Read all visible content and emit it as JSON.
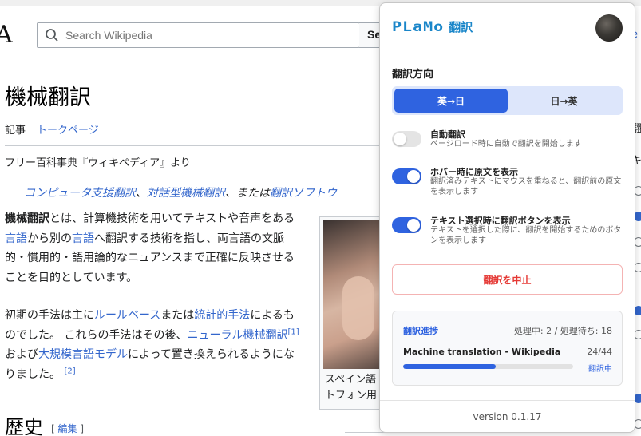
{
  "wiki": {
    "logo_fragment": "A",
    "search_placeholder": "Search Wikipedia",
    "search_button": "Se",
    "page_title": "機械翻訳",
    "tabs": {
      "article": "記事",
      "talk": "トークページ"
    },
    "from_line": "フリー百科事典『ウィキペディア』より",
    "hatnote": {
      "link1": "コンピュータ支援翻訳",
      "sep1": "、",
      "link2": "対話型機械翻訳",
      "sep2": "、または",
      "link3": "翻訳ソフトウ"
    },
    "para1": {
      "bold": "機械翻訳",
      "t1": "とは、計算機技術を用いてテキストや音声をある",
      "link1": "言語",
      "t2": "から別の",
      "link2": "言語",
      "t3": "へ翻訳する技術を指し、両言語の文脈的・慣用的・語用論的なニュアンスまで正確に反映させることを目的としています。"
    },
    "para2": {
      "t1": "初期の手法は主に",
      "link1": "ルールベース",
      "t2": "または",
      "link2": "統計的手法",
      "t3": "によるものでした。 これらの手法はその後、",
      "link3": "ニューラル機械翻訳",
      "ref1": "[1]",
      "t4": "および",
      "link4": "大規模言語モデル",
      "t5": "によって置き換えられるようになりました。 ",
      "ref2": "[2]"
    },
    "figure_caption_1": "スペイン語",
    "figure_caption_2": "トフォン用",
    "section_heading": "歴史",
    "edit_open": "[ ",
    "edit_link": "編集",
    "edit_close": " ]",
    "right_fragments": [
      "e",
      "翻",
      "キ"
    ]
  },
  "popup": {
    "brand_logo": "PLaMo",
    "brand_suffix": "翻訳",
    "direction_label": "翻訳方向",
    "direction_options": [
      "英→日",
      "日→英"
    ],
    "options": [
      {
        "title": "自動翻訳",
        "desc": "ページロード時に自動で翻訳を開始します",
        "enabled": false
      },
      {
        "title": "ホバー時に原文を表示",
        "desc": "翻訳済みテキストにマウスを重ねると、翻訳前の原文を表示します",
        "enabled": true
      },
      {
        "title": "テキスト選択時に翻訳ボタンを表示",
        "desc": "テキストを選択した際に、翻訳を開始するためのボタンを表示します",
        "enabled": true
      }
    ],
    "stop_button": "翻訳を中止",
    "progress": {
      "title": "翻訳進捗",
      "counts": "処理中: 2 / 処理待ち: 18",
      "page": "Machine translation - Wikipedia",
      "fraction": "24/44",
      "fill_fraction": 0.545,
      "status": "翻訳中"
    },
    "version": "version 0.1.17",
    "colors": {
      "accent": "#2f63e0",
      "brand": "#1a86c9",
      "danger": "#e53935"
    }
  }
}
